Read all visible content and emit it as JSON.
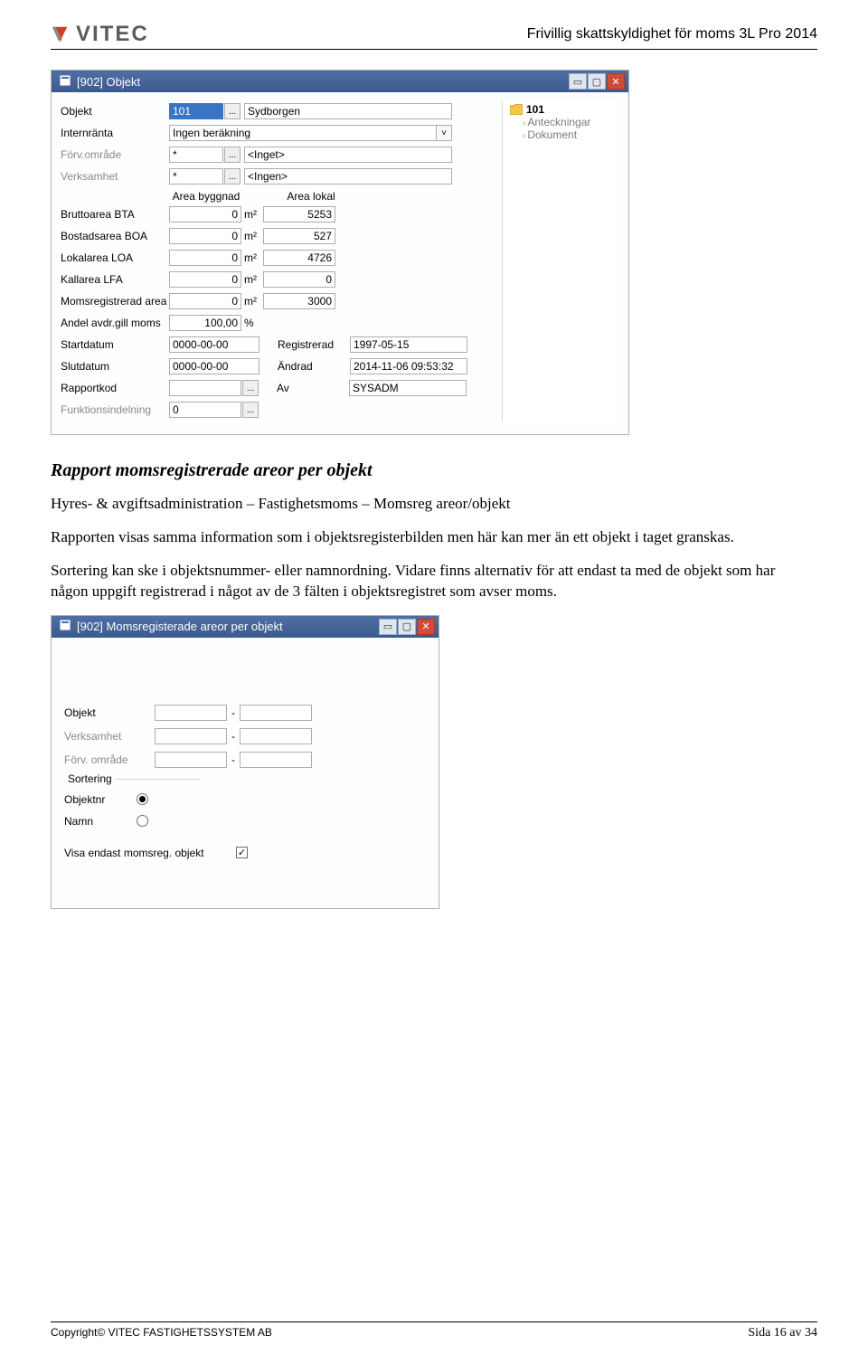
{
  "header": {
    "logo_text": "VITEC",
    "doc_title": "Frivillig skattskyldighet för moms 3L Pro 2014"
  },
  "win1": {
    "title": "[902]  Objekt",
    "labels": {
      "objekt": "Objekt",
      "internranta": "Internränta",
      "forv": "Förv.område",
      "verks": "Verksamhet",
      "area_byggnad": "Area byggnad",
      "area_lokal": "Area lokal",
      "bta": "Bruttoarea BTA",
      "boa": "Bostadsarea BOA",
      "loa": "Lokalarea LOA",
      "lfa": "Kallarea LFA",
      "momsarea": "Momsregistrerad area",
      "andel": "Andel avdr.gill moms",
      "startdatum": "Startdatum",
      "slutdatum": "Slutdatum",
      "rapportkod": "Rapportkod",
      "funk": "Funktionsindelning",
      "registrerad": "Registrerad",
      "andrad": "Ändrad",
      "av": "Av"
    },
    "values": {
      "objekt_id": "101",
      "objekt_namn": "Sydborgen",
      "internranta": "Ingen beräkning",
      "forv_code": "*",
      "forv_name": "<Inget>",
      "verks_code": "*",
      "verks_name": "<Ingen>",
      "bta_b": "0",
      "bta_l": "5253",
      "boa_b": "0",
      "boa_l": "527",
      "loa_b": "0",
      "loa_l": "4726",
      "lfa_b": "0",
      "lfa_l": "0",
      "moms_b": "0",
      "moms_l": "3000",
      "andel": "100,00",
      "startdatum": "0000-00-00",
      "slutdatum": "0000-00-00",
      "rapportkod": "",
      "funk": "0",
      "registrerad": "1997-05-15",
      "andrad": "2014-11-06 09:53:32",
      "av": "SYSADM",
      "unit_m2": "m²",
      "unit_pct": "%"
    },
    "tree": {
      "root": "101",
      "child1": "Anteckningar",
      "child2": "Dokument"
    }
  },
  "section": {
    "heading": "Rapport momsregistrerade areor per objekt",
    "p1": "Hyres- & avgiftsadministration – Fastighetsmoms – Momsreg areor/objekt",
    "p2": "Rapporten visas samma information som i objektsregisterbilden men här kan mer än ett objekt i taget granskas.",
    "p3": "Sortering kan ske i objektsnummer- eller namnordning. Vidare finns alternativ för att endast ta med de objekt som har någon uppgift registrerad i något av de 3 fälten i objektsregistret som avser moms."
  },
  "win2": {
    "title": "[902]  Momsregisterade areor per objekt",
    "labels": {
      "objekt": "Objekt",
      "verks": "Verksamhet",
      "forv": "Förv. område",
      "sortering": "Sortering",
      "objektnr": "Objektnr",
      "namn": "Namn",
      "visa": "Visa endast momsreg. objekt"
    },
    "values": {
      "dash": "-",
      "checkmark": "✓"
    }
  },
  "footer": {
    "copyright": "Copyright© VITEC FASTIGHETSSYSTEM AB",
    "page": "Sida 16 av 34"
  }
}
